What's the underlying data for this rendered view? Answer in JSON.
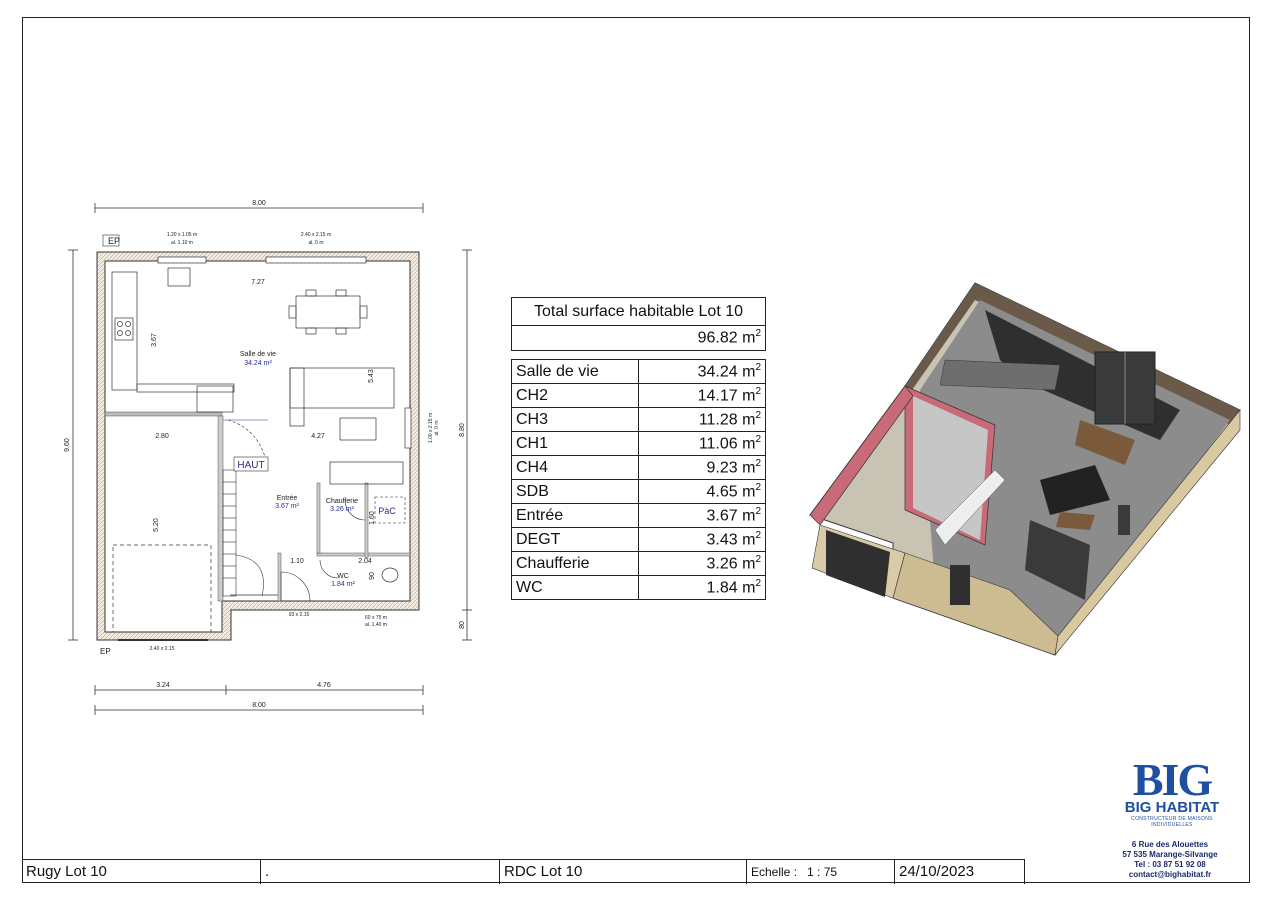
{
  "dimensions": {
    "top_total": "8.00",
    "bottom_left": "3.24",
    "bottom_right": "4.76",
    "bottom_total": "8.00",
    "left_total": "9.60",
    "right_total": "8.80",
    "right_small": "80",
    "living_width": "7.27",
    "living_depth": "3.67",
    "living_right": "5.43",
    "garage_width": "2.80",
    "garage_depth": "5.20",
    "living_bottom": "4.27",
    "chaufferie_h": "1.60",
    "wc_w": "2.04",
    "degt_w": "1.10",
    "wc_h": "90"
  },
  "openings": {
    "win1": "1.20 x 1.05 m",
    "win1_h": "al. 1.10 m",
    "win2": "2.40 x 2.15 m",
    "win2_h": "al. 0 m",
    "win3": "1.00 x 2.15 m",
    "win3_h": "al. 0 m",
    "garage_door": "2.40 x 2.15",
    "entry_door": "93 x 2.15",
    "wc_win": "60 x 75 m",
    "wc_win_h": "al. 1.40 m"
  },
  "plan_labels": {
    "ep_top": "EP",
    "ep_bottom": "EP",
    "salle_de_vie": "Salle de vie",
    "salle_de_vie_area": "34.24 m²",
    "haut": "HAUT",
    "entree": "Entrée",
    "entree_area": "3.67 m²",
    "chaufferie": "Chaufferie",
    "chaufferie_area": "3.26 m²",
    "pac": "PàC",
    "wc": "WC",
    "wc_area": "1.84 m²"
  },
  "surface_table": {
    "title": "Total surface habitable Lot 10",
    "total": "96.82 m",
    "unit_sup": "2",
    "rows": [
      {
        "name": "Salle de vie",
        "value": "34.24 m"
      },
      {
        "name": "CH2",
        "value": "14.17 m"
      },
      {
        "name": "CH3",
        "value": "11.28 m"
      },
      {
        "name": "CH1",
        "value": "11.06 m"
      },
      {
        "name": "CH4",
        "value": "9.23 m"
      },
      {
        "name": "SDB",
        "value": "4.65 m"
      },
      {
        "name": "Entrée",
        "value": "3.67 m"
      },
      {
        "name": "DEGT",
        "value": "3.43 m"
      },
      {
        "name": "Chaufferie",
        "value": "3.26 m"
      },
      {
        "name": "WC",
        "value": "1.84 m"
      }
    ]
  },
  "footer": {
    "project": "Rugy Lot 10",
    "dot": ".",
    "sheet": "RDC Lot 10",
    "scale_label": "Echelle :",
    "scale_value": "1 : 75",
    "date": "24/10/2023"
  },
  "company": {
    "logo_text": "BIG",
    "name": "BIG HABITAT",
    "tagline": "CONSTRUCTEUR DE MAISONS INDIVIDUELLES",
    "address1": "6 Rue des Alouettes",
    "address2": "57 535 Marange-Silvange",
    "phone": "Tel : 03 87 51 92 08",
    "email": "contact@bighabitat.fr"
  },
  "colors": {
    "wall_fill": "#e8ddd0",
    "roof_pink": "#c96a78",
    "facade": "#d8c9a0",
    "brand_blue": "#1f4fa0"
  }
}
